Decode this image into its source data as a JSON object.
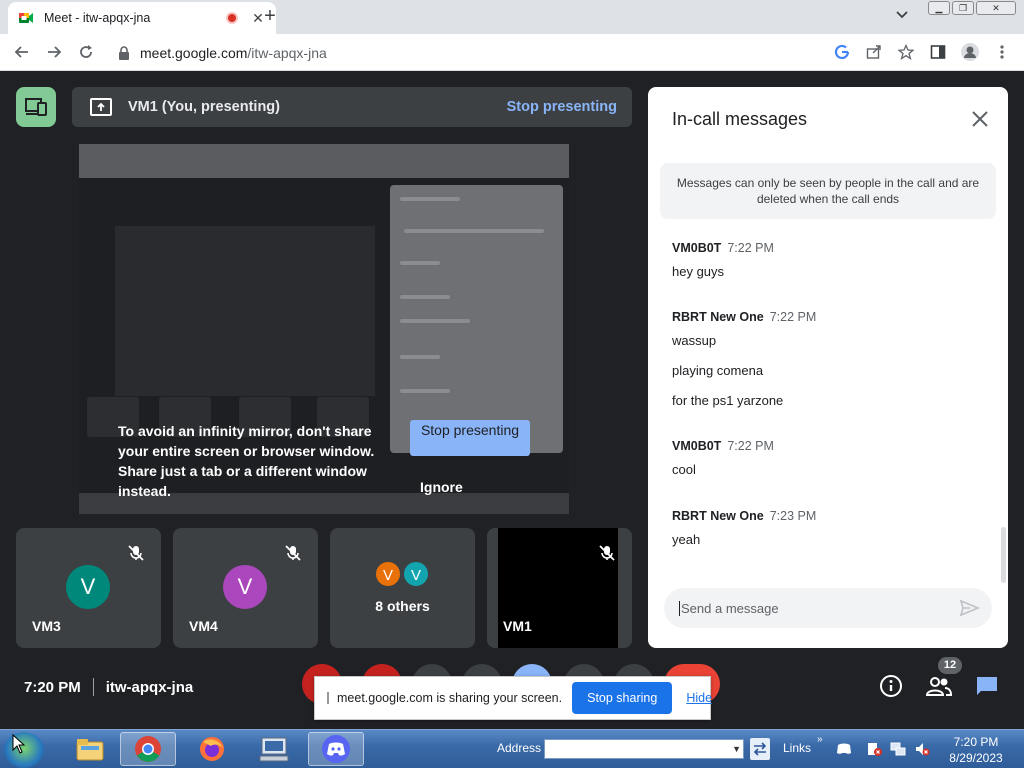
{
  "browser": {
    "tab_title": "Meet - itw-apqx-jna",
    "url_host": "meet.google.com",
    "url_path": "/itw-apqx-jna"
  },
  "meet": {
    "presenting_label": "VM1 (You, presenting)",
    "stop_presenting": "Stop presenting",
    "infinity_warning": "To avoid an infinity mirror, don't share your entire screen or browser window. Share just a tab or a different window instead.",
    "stop_presenting_big": "Stop presenting",
    "ignore": "Ignore",
    "tiles": [
      {
        "name": "VM3",
        "initial": "V",
        "color": "#00897b"
      },
      {
        "name": "VM4",
        "initial": "V",
        "color": "#ab47bc"
      },
      {
        "name": "",
        "others_label": "8 others",
        "initials": [
          "V",
          "V"
        ],
        "colors": [
          "#e8710a",
          "#12a4af"
        ]
      },
      {
        "name": "VM1"
      }
    ],
    "time": "7:20 PM",
    "meeting_code": "itw-apqx-jna",
    "participant_count": "12"
  },
  "chat": {
    "title": "In-call messages",
    "notice": "Messages can only be seen by people in the call and are deleted when the call ends",
    "messages": [
      {
        "sender": "VM0B0T",
        "time": "7:22 PM",
        "lines": [
          "hey guys"
        ]
      },
      {
        "sender": "RBRT New One",
        "time": "7:22 PM",
        "lines": [
          "wassup",
          "playing comena",
          "for the ps1 yarzone"
        ]
      },
      {
        "sender": "VM0B0T",
        "time": "7:22 PM",
        "lines": [
          "cool"
        ]
      },
      {
        "sender": "RBRT New One",
        "time": "7:23 PM",
        "lines": [
          "yeah"
        ]
      }
    ],
    "input_placeholder": "Send a message"
  },
  "share_bar": {
    "text": "meet.google.com is sharing your screen.",
    "stop_sharing": "Stop sharing",
    "hide": "Hide"
  },
  "taskbar": {
    "address_label": "Address",
    "links_label": "Links",
    "time": "7:20 PM",
    "date": "8/29/2023"
  }
}
